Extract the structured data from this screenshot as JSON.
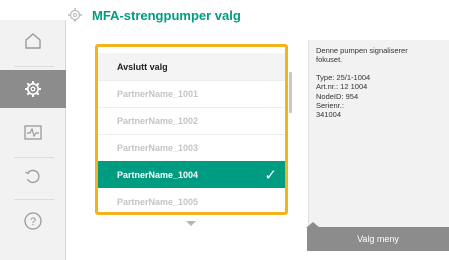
{
  "header": {
    "title": "MFA-strengpumper valg",
    "icon": "gear-icon"
  },
  "rail": {
    "items": [
      {
        "name": "home-icon",
        "active": false
      },
      {
        "name": "gear-icon",
        "active": true
      },
      {
        "name": "diagnostics-icon",
        "active": false
      },
      {
        "name": "undo-icon",
        "active": false
      },
      {
        "name": "help-icon",
        "active": false
      }
    ]
  },
  "list": {
    "items": [
      {
        "label": "Avslutt valg"
      },
      {
        "label": "PartnerName_1001"
      },
      {
        "label": "PartnerName_1002"
      },
      {
        "label": "PartnerName_1003"
      },
      {
        "label": "PartnerName_1004",
        "checkmark": "✓"
      },
      {
        "label": "PartnerName_1005"
      }
    ]
  },
  "info": {
    "description_line1": "Denne pumpen signaliserer",
    "description_line2": "fokuset.",
    "type": "Type: 25/1-1004",
    "art_nr": "Art.nr.: 12 1004",
    "node_id": "NodeID: 954",
    "serial_label": "Serienr.:",
    "serial_value": "341004"
  },
  "context_button": {
    "label": "Valg meny"
  },
  "colors": {
    "accent_green": "#009c82",
    "focus_yellow": "#f3b31f",
    "rail_active": "#8c8c8c"
  }
}
